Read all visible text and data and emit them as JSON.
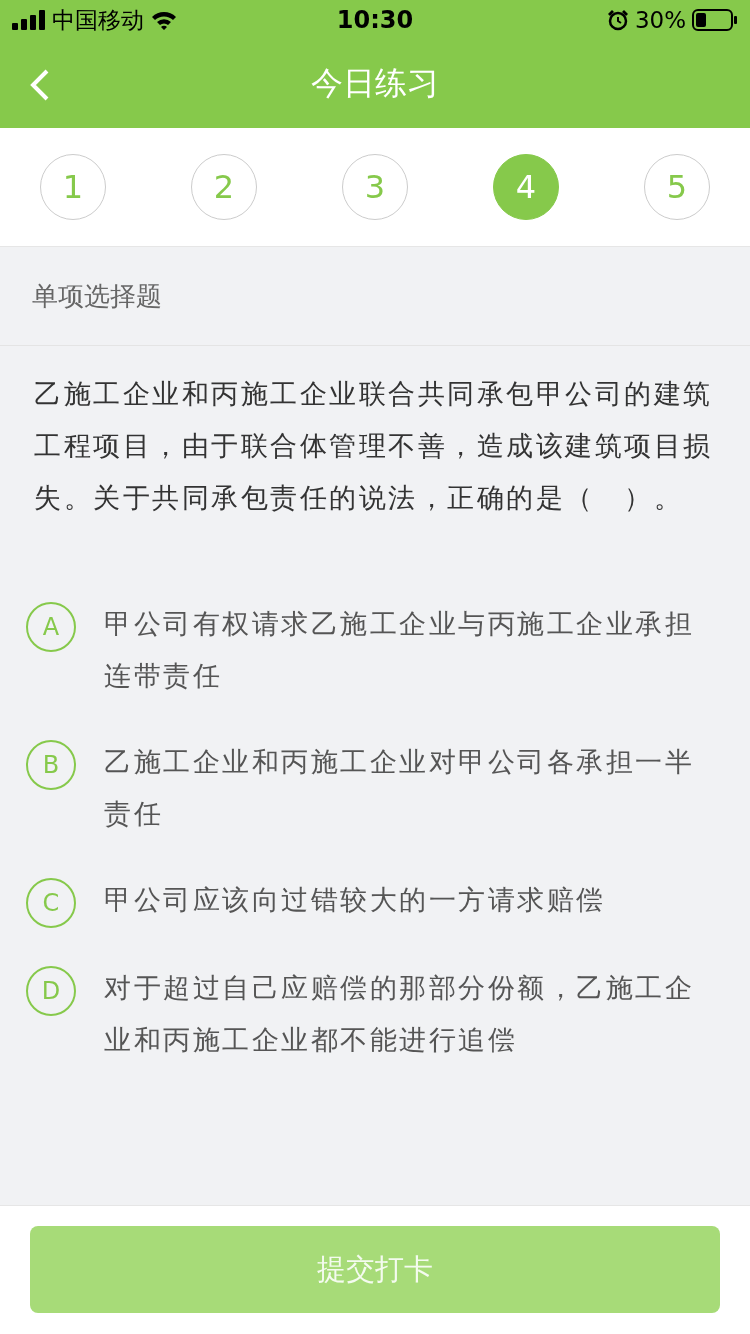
{
  "status_bar": {
    "carrier": "中国移动",
    "time": "10:30",
    "battery": "30%"
  },
  "nav": {
    "title": "今日练习"
  },
  "question_tabs": [
    {
      "label": "1",
      "selected": false
    },
    {
      "label": "2",
      "selected": false
    },
    {
      "label": "3",
      "selected": false
    },
    {
      "label": "4",
      "selected": true
    },
    {
      "label": "5",
      "selected": false
    }
  ],
  "question_type": "单项选择题",
  "question": "乙施工企业和丙施工企业联合共同承包甲公司的建筑工程项目，由于联合体管理不善，造成该建筑项目损失。关于共同承包责任的说法，正确的是（　）。",
  "options": [
    {
      "letter": "A",
      "text": "甲公司有权请求乙施工企业与丙施工企业承担连带责任",
      "selected": false
    },
    {
      "letter": "B",
      "text": "乙施工企业和丙施工企业对甲公司各承担一半责任",
      "selected": false
    },
    {
      "letter": "C",
      "text": "甲公司应该向过错较大的一方请求赔偿",
      "selected": false
    },
    {
      "letter": "D",
      "text": "对于超过自己应赔偿的那部分份额，乙施工企业和丙施工企业都不能进行追偿",
      "selected": false
    }
  ],
  "submit": {
    "label": "提交打卡",
    "disabled": true
  }
}
